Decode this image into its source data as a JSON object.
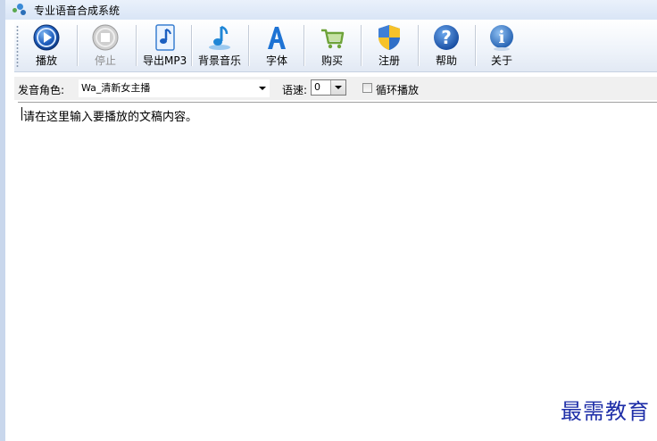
{
  "window": {
    "title": "专业语音合成系统",
    "border_color": "#c9d7ec"
  },
  "toolbar": {
    "buttons": [
      {
        "label": "播放",
        "icon": "play-icon",
        "disabled": false
      },
      {
        "label": "停止",
        "icon": "stop-icon",
        "disabled": true
      },
      {
        "label": "导出MP3",
        "icon": "music-note-icon",
        "disabled": false
      },
      {
        "label": "背景音乐",
        "icon": "background-music-icon",
        "disabled": false
      },
      {
        "label": "字体",
        "icon": "font-icon",
        "disabled": false
      },
      {
        "label": "购买",
        "icon": "shopping-cart-icon",
        "disabled": false
      },
      {
        "label": "注册",
        "icon": "shield-icon",
        "disabled": false
      },
      {
        "label": "帮助",
        "icon": "help-icon",
        "disabled": false
      },
      {
        "label": "关于",
        "icon": "info-icon",
        "disabled": false
      }
    ]
  },
  "options": {
    "voice_label": "发音角色:",
    "voice_value": "Wa_清新女主播",
    "speed_label": "语速:",
    "speed_value": "0",
    "loop_label": "循环播放",
    "loop_checked": false
  },
  "editor": {
    "text": "请在这里输入要播放的文稿内容。"
  },
  "watermark": {
    "text": "最需教育",
    "color": "#1f2fa8"
  }
}
